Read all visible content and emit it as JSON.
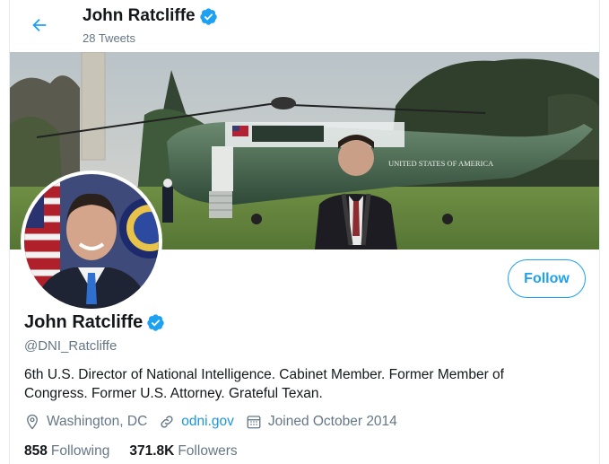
{
  "header": {
    "name": "John Ratcliffe",
    "tweet_count": "28 Tweets"
  },
  "profile": {
    "name": "John Ratcliffe",
    "handle": "@DNI_Ratcliffe",
    "bio": "6th U.S. Director of National Intelligence. Cabinet Member. Former Member of Congress. Former U.S. Attorney. Grateful Texan.",
    "location": "Washington, DC",
    "website": "odni.gov",
    "joined": "Joined October 2014",
    "following_count": "858",
    "following_label": "Following",
    "followers_count": "371.8K",
    "followers_label": "Followers"
  },
  "buttons": {
    "follow": "Follow"
  },
  "banner": {
    "helicopter_text": "UNITED STATES OF AMERICA"
  },
  "colors": {
    "accent": "#1da1f2",
    "link": "#1b95e0",
    "secondary_text": "#657786"
  },
  "icons": {
    "back": "arrow-left-icon",
    "verified": "verified-badge-icon",
    "location": "location-pin-icon",
    "link": "link-icon",
    "calendar": "calendar-icon"
  }
}
